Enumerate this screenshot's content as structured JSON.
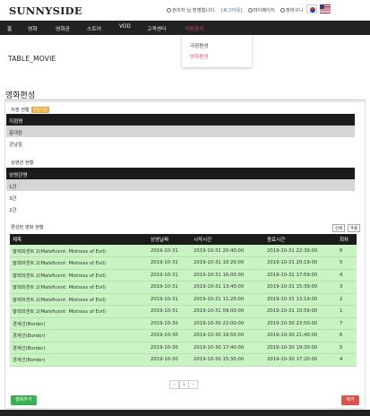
{
  "header": {
    "logo": "SUNNYSIDE",
    "greeting": "관리자 님 환영합니다.",
    "logout": "[로그아웃]",
    "mypage": "마이페이지",
    "cart": "장바구니"
  },
  "nav": {
    "items": [
      "홈",
      "영화",
      "영화관",
      "스토어",
      "VOD",
      "고객센터",
      "극장관리"
    ],
    "dropdown": [
      "극장편성",
      "영화편성"
    ]
  },
  "page": {
    "label": "TABLE_MOVIE",
    "section_title": "영화편성"
  },
  "branch": {
    "label": "지점 현황",
    "badge": "영업지점",
    "header": "지점명",
    "rows": [
      "홍대점",
      "강남점"
    ]
  },
  "screens": {
    "label": "상영관 현황",
    "header": "상영관명",
    "rows": [
      "1관",
      "3관",
      "2관"
    ]
  },
  "schedule": {
    "label": "편성된 영화 현황",
    "buttons": [
      "전체",
      "추출"
    ],
    "columns": [
      "제목",
      "상영날짜",
      "시작시간",
      "종료시간",
      "회차"
    ],
    "rows": [
      [
        "말레피센트 2(Maleficent: Mistress of Evil)",
        "2019-10-31",
        "2019-10-31 20:40:00",
        "2019-10-31 22:39:00",
        "6"
      ],
      [
        "말레피센트 2(Maleficent: Mistress of Evil)",
        "2019-10-31",
        "2019-10-31 18:20:00",
        "2019-10-31 20:19:00",
        "5"
      ],
      [
        "말레피센트 2(Maleficent: Mistress of Evil)",
        "2019-10-31",
        "2019-10-31 16:00:00",
        "2019-10-31 17:59:00",
        "4"
      ],
      [
        "말레피센트 2(Maleficent: Mistress of Evil)",
        "2019-10-31",
        "2019-10-31 13:40:00",
        "2019-10-31 15:39:00",
        "3"
      ],
      [
        "말레피센트 2(Maleficent: Mistress of Evil)",
        "2019-10-31",
        "2019-10-31 11:20:00",
        "2019-10-31 13:19:00",
        "2"
      ],
      [
        "말레피센트 2(Maleficent: Mistress of Evil)",
        "2019-10-31",
        "2019-10-31 09:00:00",
        "2019-10-31 10:59:00",
        "1"
      ],
      [
        "경계선(Border)",
        "2019-10-30",
        "2019-10-30 22:00:00",
        "2019-10-30 23:50:00",
        "7"
      ],
      [
        "경계선(Border)",
        "2019-10-30",
        "2019-10-30 19:50:00",
        "2019-10-30 21:40:00",
        "6"
      ],
      [
        "경계선(Border)",
        "2019-10-30",
        "2019-10-30 17:40:00",
        "2019-10-30 19:30:00",
        "5"
      ],
      [
        "경계선(Border)",
        "2019-10-30",
        "2019-10-30 15:30:00",
        "2019-10-30 17:20:00",
        "4"
      ]
    ]
  },
  "pagination": [
    "‹",
    "1",
    "›"
  ],
  "actions": {
    "add": "영화추가",
    "delete": "제거"
  },
  "colors": {
    "nav_bg": "#222222",
    "accent": "#e04b6a",
    "row_green": "#c9f3c3",
    "add_button": "#3aae55",
    "delete_button": "#d9534f"
  }
}
